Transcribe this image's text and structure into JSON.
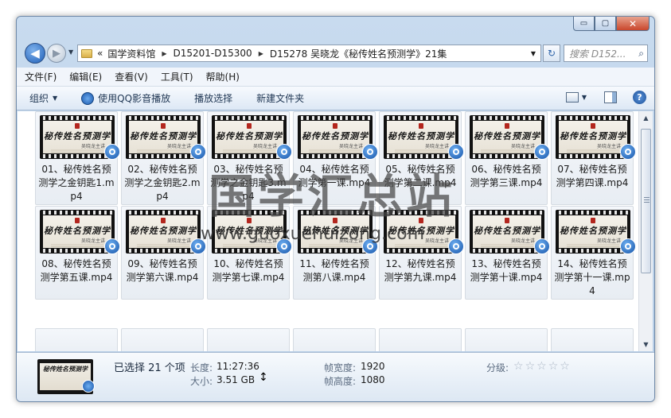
{
  "window": {
    "caption": {
      "minimize": "▭",
      "maximize": "▢",
      "close": "✕"
    }
  },
  "nav": {
    "back_glyph": "◀",
    "forward_glyph": "▶",
    "history_drop": "▼",
    "address": {
      "overflow": "«",
      "crumbs": [
        "国学资料馆",
        "D15201-D15300",
        "D15278 吴晓龙《秘传姓名预测学》21集"
      ],
      "separator": "▶",
      "drop": "▼"
    },
    "refresh_glyph": "↻",
    "search_placeholder": "搜索 D152...",
    "search_icon": "search-icon"
  },
  "menu": [
    "文件(F)",
    "编辑(E)",
    "查看(V)",
    "工具(T)",
    "帮助(H)"
  ],
  "toolbar": {
    "organize": "组织",
    "play_qq": "使用QQ影音播放",
    "play_selection": "播放选择",
    "new_folder": "新建文件夹",
    "caret": "▼",
    "help": "?"
  },
  "thumb_text": {
    "title": "秘传姓名预测学",
    "sub": "吴晓龙主讲"
  },
  "files": [
    "01、秘传姓名预测学之金钥匙1.mp4",
    "02、秘传姓名预测学之金钥匙2.mp4",
    "03、秘传姓名预测学之金钥匙3.mp4",
    "04、秘传姓名预测学第一课.mp4",
    "05、秘传姓名预测学第二课.mp4",
    "06、秘传姓名预测学第三课.mp4",
    "07、秘传姓名预测学第四课.mp4",
    "08、秘传姓名预测学第五课.mp4",
    "09、秘传姓名预测学第六课.mp4",
    "10、秘传姓名预测学第七课.mp4",
    "11、秘传姓名预测第八课.mp4",
    "12、秘传姓名预测学第九课.mp4",
    "13、秘传姓名预测学第十课.mp4",
    "14、秘传姓名预测学第十一课.mp4"
  ],
  "watermark": {
    "cn": "国学汇总站",
    "url": "www.guoxuehuizong.com"
  },
  "details": {
    "selected": "已选择 21 个项",
    "length_key": "长度:",
    "length_val": "11:27:36",
    "size_key": "大小:",
    "size_val": "3.51 GB",
    "width_key": "帧宽度:",
    "width_val": "1920",
    "height_key": "帧高度:",
    "height_val": "1080",
    "rating_key": "分级:",
    "stars": [
      "☆",
      "☆",
      "☆",
      "☆",
      "☆"
    ]
  },
  "scroll": {
    "up": "▲",
    "down": "▼"
  },
  "cursor": "↕",
  "colors": {
    "accent": "#1f5fb8",
    "close": "#c9462b",
    "frame": "#b6cde6"
  }
}
